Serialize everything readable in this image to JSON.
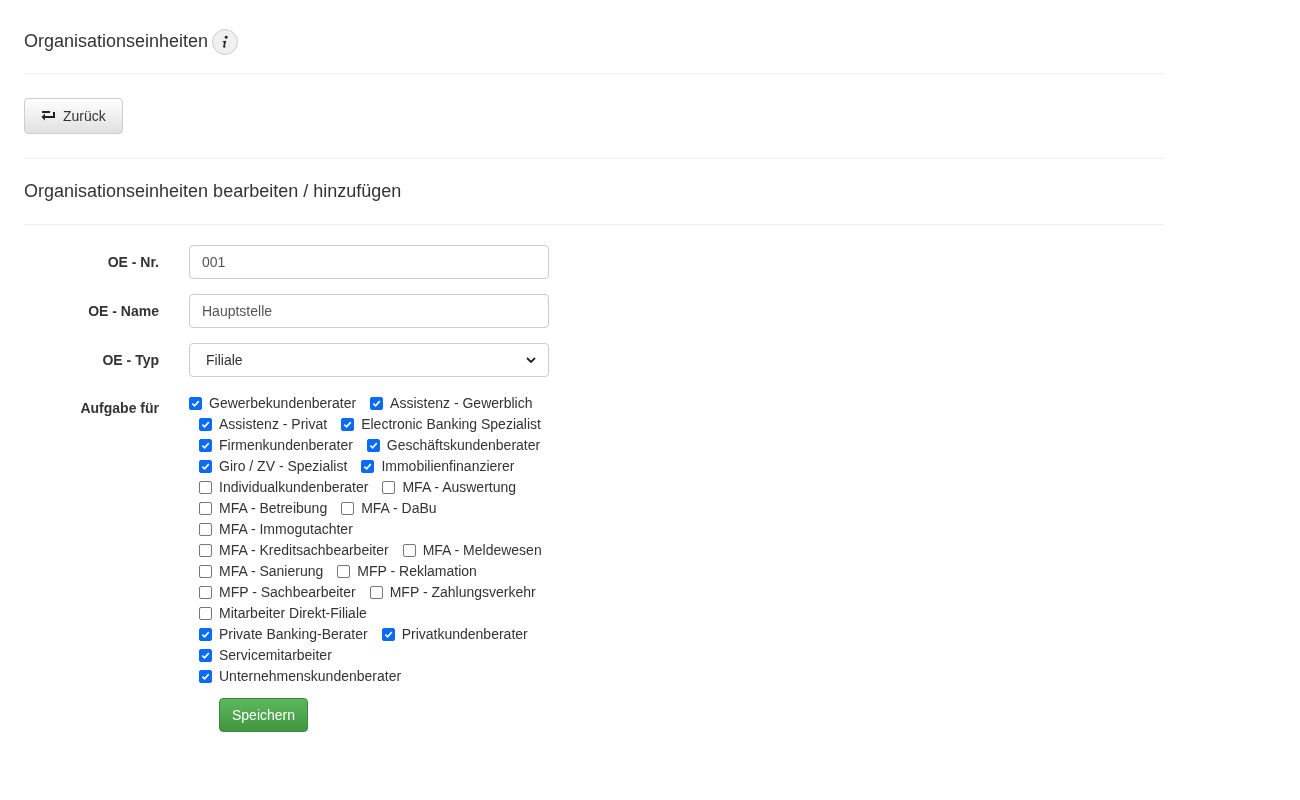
{
  "page_title": "Organisationseinheiten",
  "back_button": "Zurück",
  "section_title": "Organisationseinheiten bearbeiten / hinzufügen",
  "form": {
    "fields": [
      {
        "kind": "text",
        "label": "OE - Nr.",
        "value": "001"
      },
      {
        "kind": "text",
        "label": "OE - Name",
        "value": "Hauptstelle"
      },
      {
        "kind": "select",
        "label": "OE - Typ",
        "value": "Filiale"
      }
    ],
    "tasks_label": "Aufgabe für",
    "tasks": [
      {
        "label": "Gewerbekundenberater",
        "checked": true
      },
      {
        "label": "Assistenz - Gewerblich",
        "checked": true
      },
      {
        "label": "Assistenz - Privat",
        "checked": true
      },
      {
        "label": "Electronic Banking Spezialist",
        "checked": true
      },
      {
        "label": "Firmenkundenberater",
        "checked": true
      },
      {
        "label": "Geschäftskundenberater",
        "checked": true
      },
      {
        "label": "Giro / ZV - Spezialist",
        "checked": true
      },
      {
        "label": "Immobilienfinanzierer",
        "checked": true
      },
      {
        "label": "Individualkundenberater",
        "checked": false
      },
      {
        "label": "MFA - Auswertung",
        "checked": false
      },
      {
        "label": "MFA - Betreibung",
        "checked": false
      },
      {
        "label": "MFA - DaBu",
        "checked": false
      },
      {
        "label": "MFA - Immogutachter",
        "checked": false
      },
      {
        "label": "MFA - Kreditsachbearbeiter",
        "checked": false
      },
      {
        "label": "MFA - Meldewesen",
        "checked": false
      },
      {
        "label": "MFA - Sanierung",
        "checked": false
      },
      {
        "label": "MFP - Reklamation",
        "checked": false
      },
      {
        "label": "MFP - Sachbearbeiter",
        "checked": false
      },
      {
        "label": "MFP - Zahlungsverkehr",
        "checked": false
      },
      {
        "label": "Mitarbeiter Direkt-Filiale",
        "checked": false
      },
      {
        "label": "Private Banking-Berater",
        "checked": true
      },
      {
        "label": "Privatkundenberater",
        "checked": true
      },
      {
        "label": "Servicemitarbeiter",
        "checked": true
      },
      {
        "label": "Unternehmenskundenberater",
        "checked": true
      }
    ],
    "save_button": "Speichern"
  }
}
